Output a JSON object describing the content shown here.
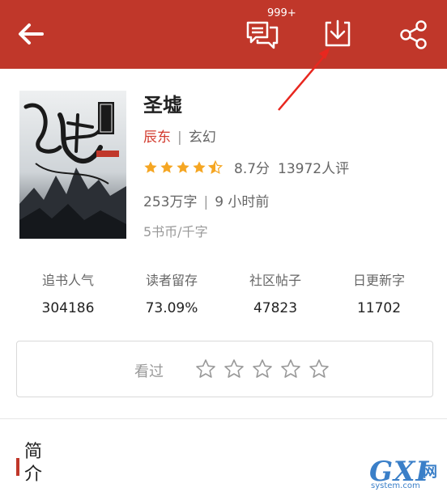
{
  "header": {
    "comment_badge": "999+",
    "icons": [
      "back-arrow-icon",
      "comments-icon",
      "download-icon",
      "share-icon"
    ],
    "bar_color": "#c0372a"
  },
  "book": {
    "title": "圣墟",
    "author": "辰东",
    "separator": "|",
    "category": "玄幻",
    "rating_stars": 4.5,
    "score": "8.7分",
    "review_count": "13972人评",
    "word_count": "253万字",
    "updated": "9 小时前",
    "price": "5书币/千字"
  },
  "stats": [
    {
      "label": "追书人气",
      "value": "304186"
    },
    {
      "label": "读者留存",
      "value": "73.09%"
    },
    {
      "label": "社区帖子",
      "value": "47823"
    },
    {
      "label": "日更新字",
      "value": "11702"
    }
  ],
  "rate_box": {
    "label": "看过",
    "stars": 0,
    "max_stars": 5
  },
  "intro": {
    "heading": "简介"
  },
  "watermark": {
    "brand": "GXI",
    "cn": "网",
    "domain": "system.com"
  },
  "colors": {
    "accent": "#c0372a",
    "author": "#d23a2d",
    "star": "#f5a623"
  }
}
